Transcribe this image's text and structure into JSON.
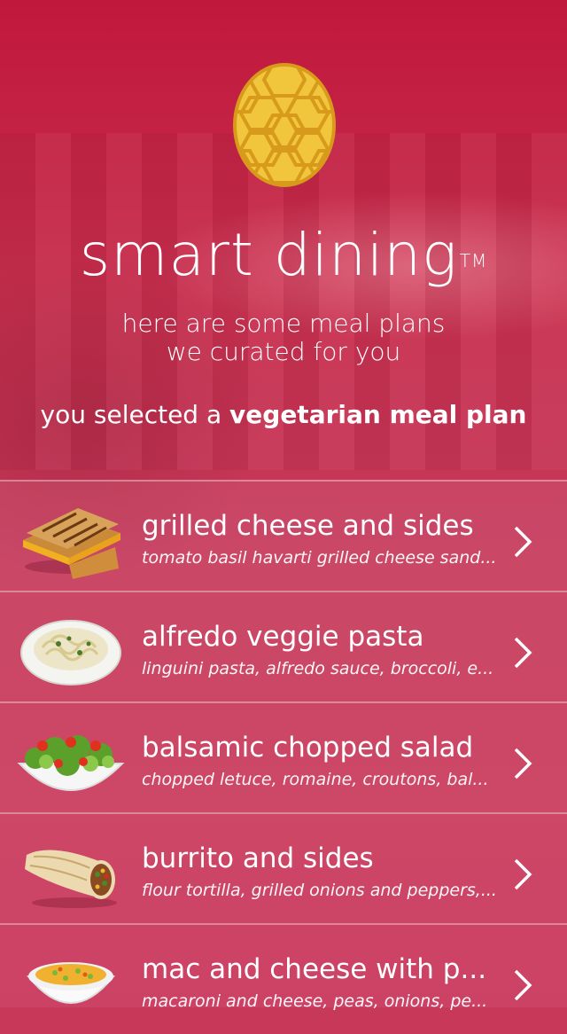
{
  "app": {
    "title": "smart dining",
    "trademark": "TM"
  },
  "subtitle": {
    "line1": "here are some meal plans",
    "line2": "we curated for you"
  },
  "selection": {
    "prefix": "you selected a ",
    "plan": "vegetarian meal plan"
  },
  "meals": [
    {
      "name": "grilled cheese and sides",
      "description": "tomato basil havarti grilled cheese sand...",
      "icon": "grilled-cheese-image"
    },
    {
      "name": "alfredo veggie pasta",
      "description": "linguini pasta, alfredo sauce, broccoli, e...",
      "icon": "pasta-image"
    },
    {
      "name": "balsamic chopped salad",
      "description": "chopped letuce, romaine, croutons, bal...",
      "icon": "salad-image"
    },
    {
      "name": "burrito and sides",
      "description": "flour tortilla, grilled onions and peppers,...",
      "icon": "burrito-image"
    },
    {
      "name": "mac and cheese with p...",
      "description": "macaroni and cheese, peas, onions, pe...",
      "icon": "mac-and-cheese-image"
    }
  ],
  "colors": {
    "brand_red": "#c4284a",
    "logo_yellow": "#f2c63c",
    "logo_outline": "#d79a1a"
  }
}
